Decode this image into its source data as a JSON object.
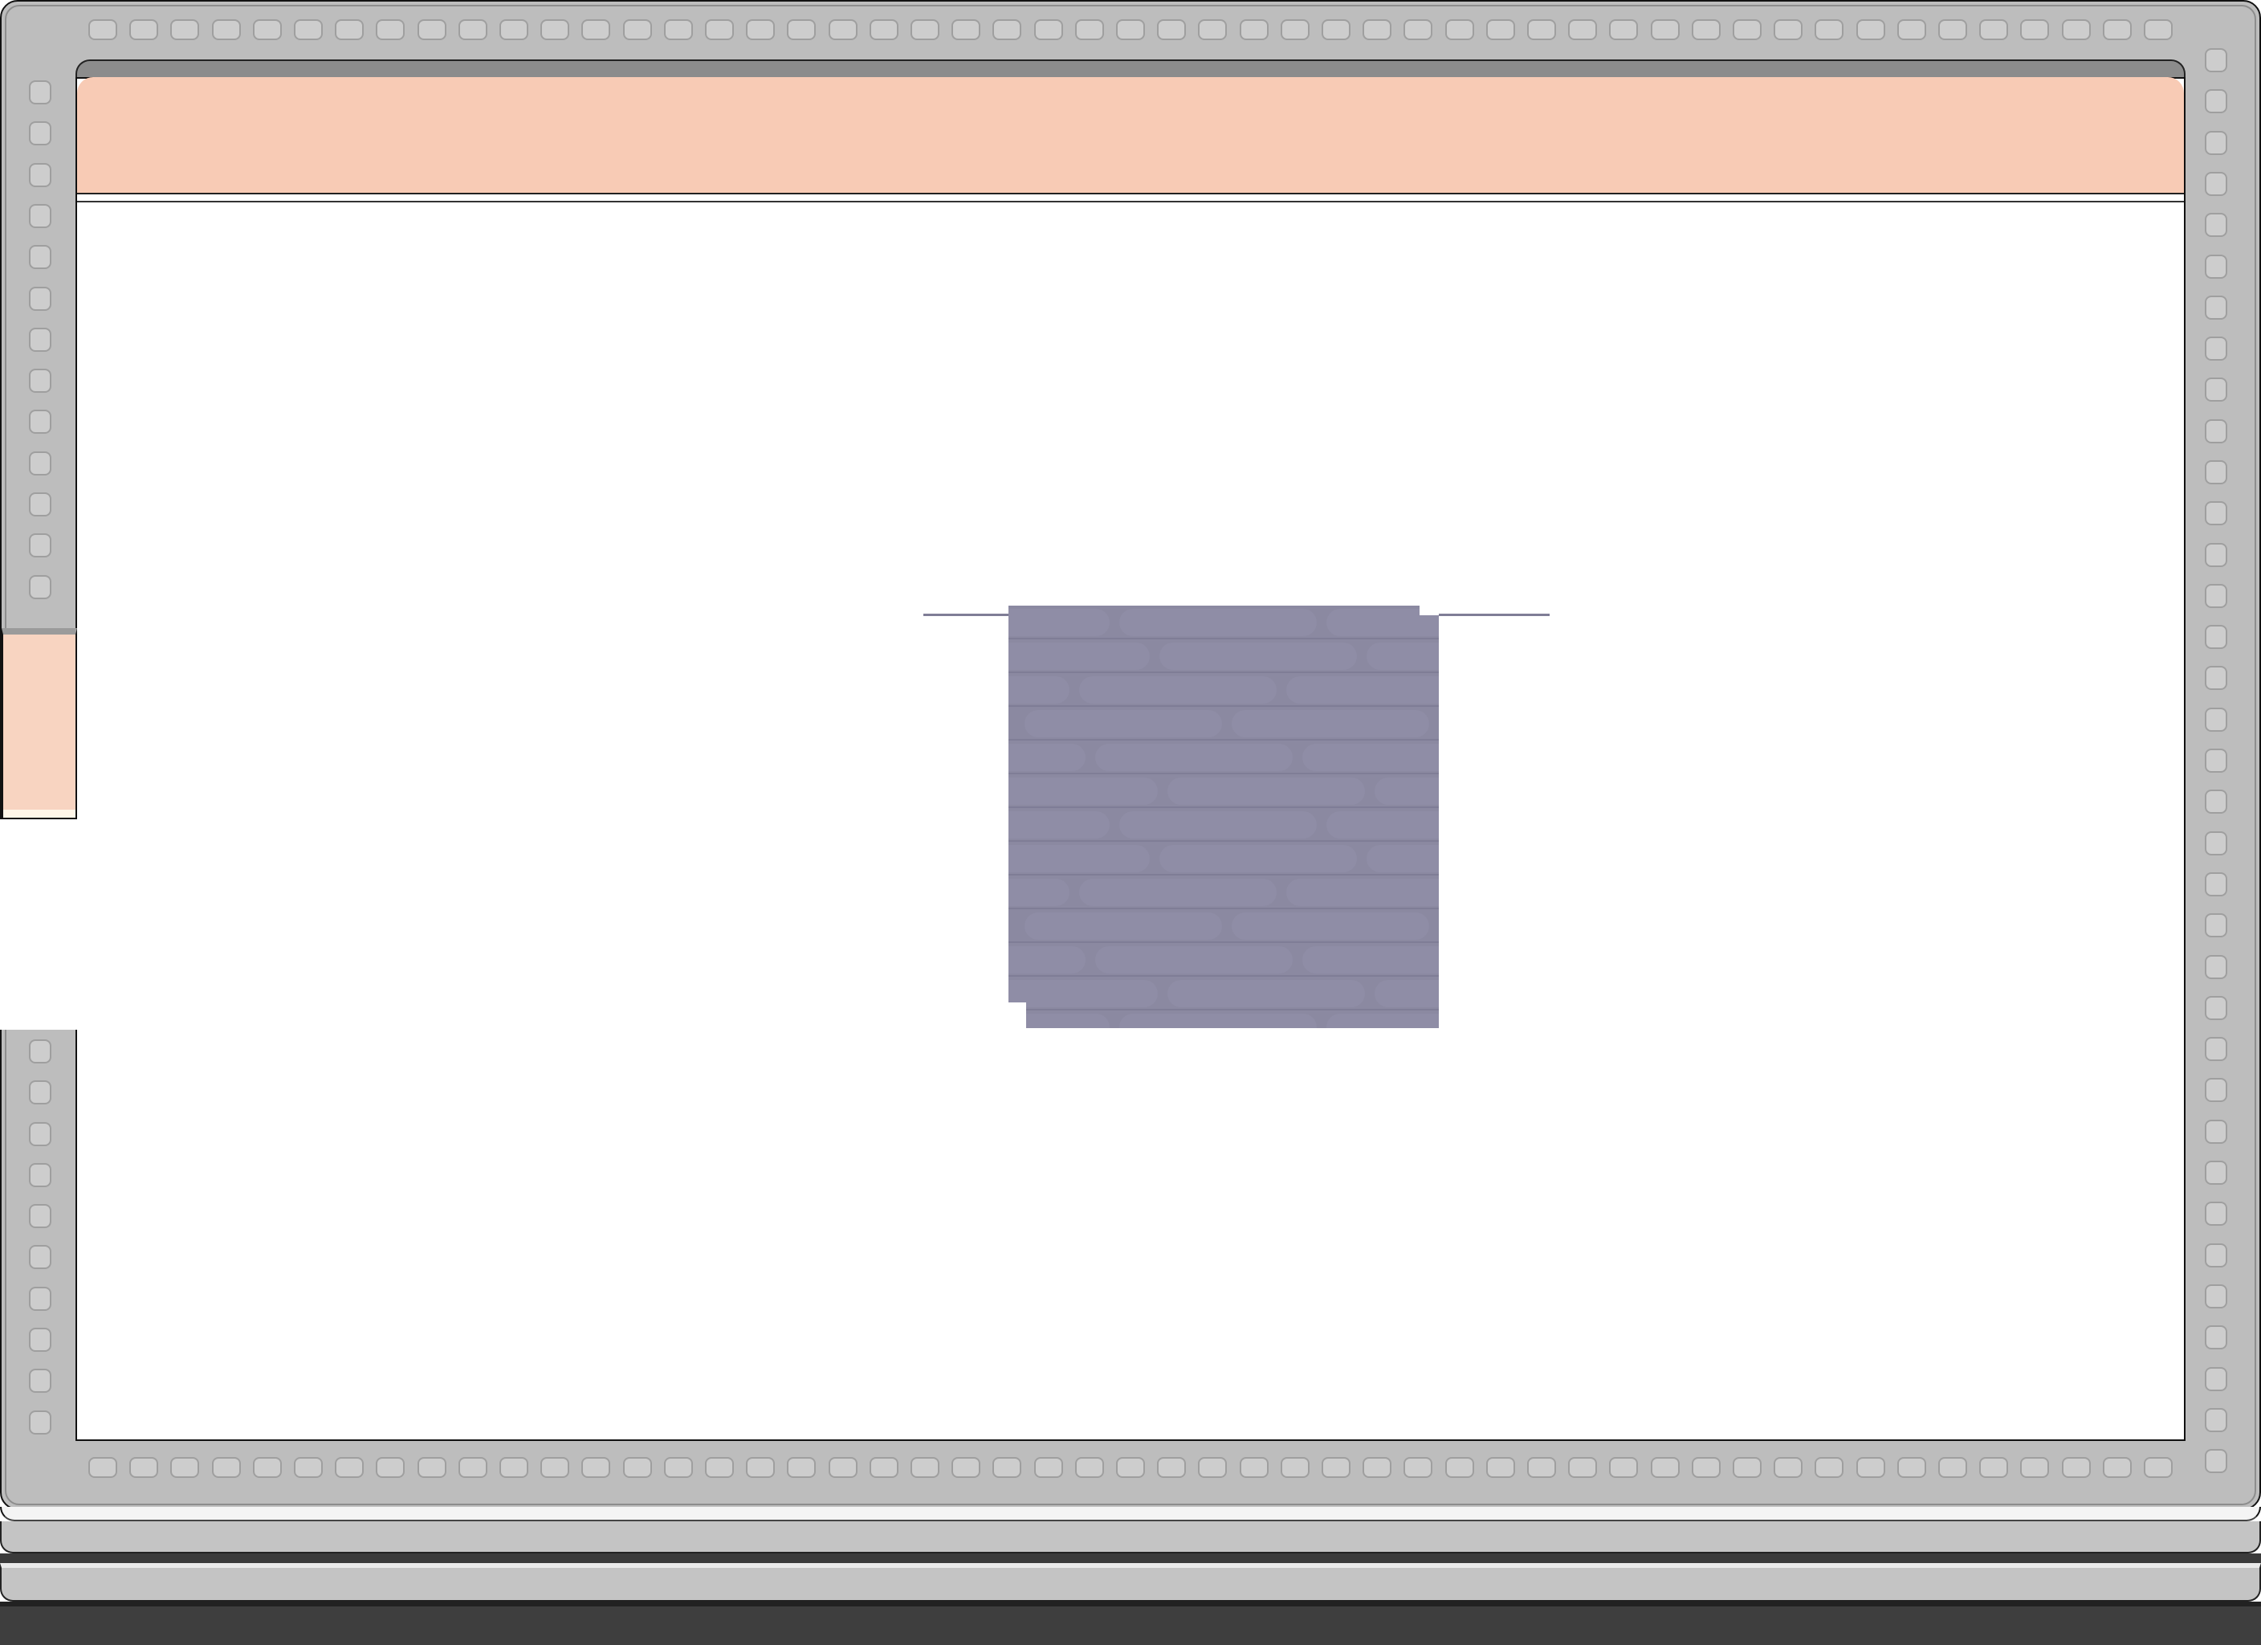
{
  "scene": {
    "name": "room",
    "colors": {
      "wall": "#bdbdbd",
      "wall_stud": "#a8a8a8",
      "floor": "#ffffff",
      "peach_strip": "#f8cbb5",
      "door_peach": "#f8d4c1",
      "block": "#8b89a1",
      "slab_dark": "#3e3e3e"
    },
    "elements": {
      "wall_icon": "brick-wall",
      "block_icon": "stone-block"
    }
  }
}
